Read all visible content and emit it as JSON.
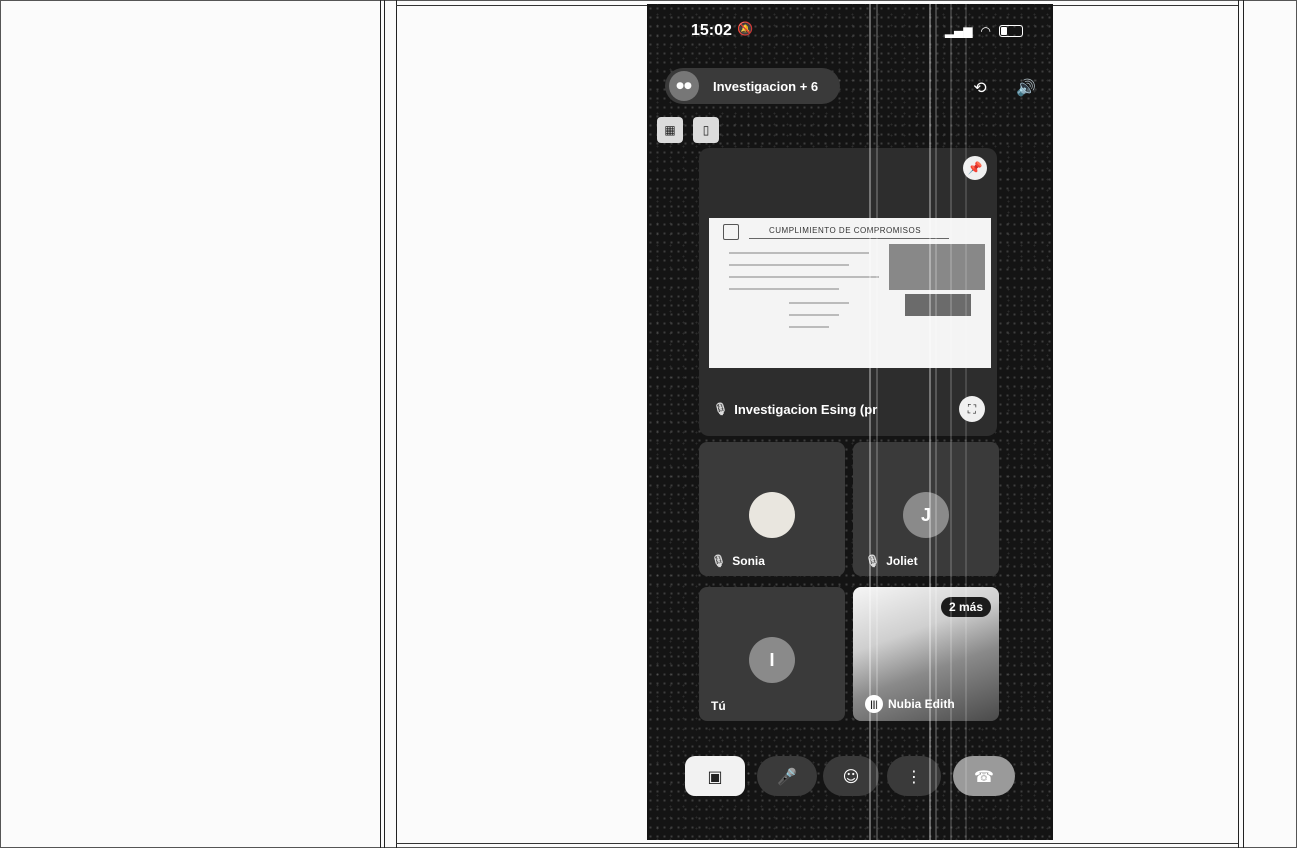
{
  "status_bar": {
    "time": "15:02"
  },
  "meeting": {
    "title": "Investigacion + 6"
  },
  "presentation": {
    "slide_title": "CUMPLIMIENTO DE COMPROMISOS",
    "presenter_name": "Investigacion Esing (pr"
  },
  "participants": [
    {
      "name": "Sonia"
    },
    {
      "name": "Joliet",
      "initial": "J"
    },
    {
      "name": "Tú",
      "initial": "I"
    },
    {
      "name": "Nubia Edith",
      "badge": "2 más"
    }
  ],
  "icons": {
    "bell_muted": "🔕",
    "camera_flip": "⟲",
    "speaker": "🔊",
    "pin": "📌",
    "fullscreen": "⛶",
    "mic_off": "🎙",
    "camera_off": "▣",
    "mic": "🎤",
    "emoji": "☺",
    "more": "⋮",
    "hangup": "☎"
  },
  "colors": {
    "tile_background": "#3a3a3a",
    "hangup_button": "#9a9a9a",
    "camera_button": "#f2f2f2"
  }
}
